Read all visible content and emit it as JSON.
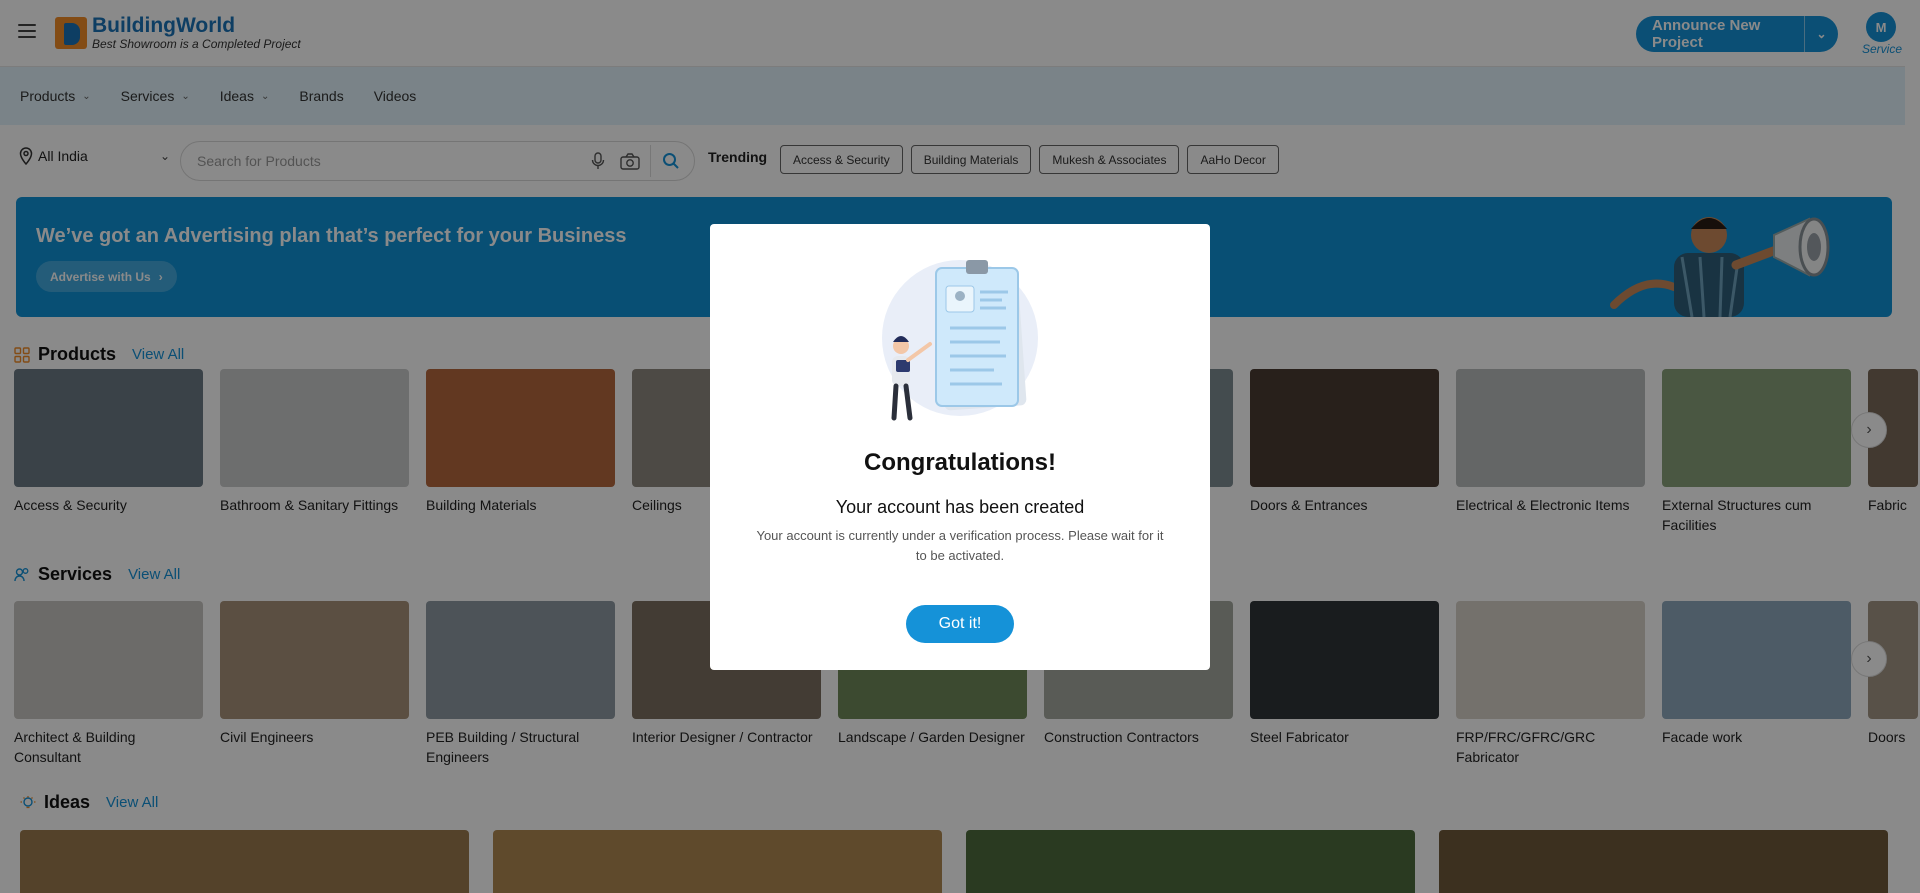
{
  "header": {
    "logo_name": "BuildingWorld",
    "logo_tagline": "Best Showroom is a Completed Project",
    "announce_label": "Announce New Project",
    "avatar_initial": "M",
    "avatar_label": "Service"
  },
  "nav": [
    {
      "label": "Products",
      "dropdown": true
    },
    {
      "label": "Services",
      "dropdown": true
    },
    {
      "label": "Ideas",
      "dropdown": true
    },
    {
      "label": "Brands",
      "dropdown": false
    },
    {
      "label": "Videos",
      "dropdown": false
    }
  ],
  "search": {
    "location": "All India",
    "placeholder": "Search for Products",
    "trending_label": "Trending",
    "chips": [
      "Access & Security",
      "Building Materials",
      "Mukesh & Associates",
      "AaHo Decor"
    ]
  },
  "banner": {
    "text": "We’ve got an Advertising plan that’s perfect for your Business",
    "button": "Advertise with Us"
  },
  "products": {
    "title": "Products",
    "view_all": "View All",
    "items": [
      {
        "label": "Access & Security",
        "color": "#6c7a85"
      },
      {
        "label": "Bathroom & Sanitary Fittings",
        "color": "#c9cbcc"
      },
      {
        "label": "Building Materials",
        "color": "#b5683d"
      },
      {
        "label": "Ceilings",
        "color": "#8f8a80"
      },
      {
        "label": "",
        "color": "#9aa0a4"
      },
      {
        "label": "",
        "color": "#7f8c93"
      },
      {
        "label": "Doors & Entrances",
        "color": "#4a3b32"
      },
      {
        "label": "Electrical & Electronic Items",
        "color": "#b9bcbd"
      },
      {
        "label": "External Structures cum Facilities",
        "color": "#8aa17a"
      },
      {
        "label": "Fabric",
        "color": "#7a6a5a"
      }
    ]
  },
  "services": {
    "title": "Services",
    "view_all": "View All",
    "items": [
      {
        "label": "Architect & Building Consultant",
        "color": "#c8c6c2"
      },
      {
        "label": "Civil Engineers",
        "color": "#a8937a"
      },
      {
        "label": "PEB Building / Structural Engineers",
        "color": "#8f9aa3"
      },
      {
        "label": "Interior Designer / Contractor",
        "color": "#7d6f60"
      },
      {
        "label": "Landscape / Garden Designer",
        "color": "#6f8a5a"
      },
      {
        "label": "Construction Contractors",
        "color": "#a4a9a0"
      },
      {
        "label": "Steel Fabricator",
        "color": "#2f3438"
      },
      {
        "label": "FRP/FRC/GFRC/GRC Fabricator",
        "color": "#d6d1c8"
      },
      {
        "label": "Facade work",
        "color": "#8ea8bd"
      },
      {
        "label": "Doors",
        "color": "#a39685"
      }
    ]
  },
  "ideas": {
    "title": "Ideas",
    "view_all": "View All",
    "items": [
      {
        "color": "#9c7a4e"
      },
      {
        "color": "#b08a52"
      },
      {
        "color": "#4f6b3e"
      },
      {
        "color": "#6f5a3a"
      }
    ]
  },
  "modal": {
    "title": "Congratulations!",
    "subtitle": "Your account has been created",
    "description": "Your account is currently under a verification process. Please wait for it to be activated.",
    "button": "Got it!"
  },
  "colors": {
    "brand_blue": "#1592d8",
    "logo_orange": "#f28c28",
    "nav_bg": "#e1f3fb",
    "overlay": "rgba(0,0,0,0.46)"
  },
  "icons": [
    "hamburger-icon",
    "location-pin-icon",
    "microphone-icon",
    "camera-icon",
    "search-icon",
    "chevron-right-icon",
    "products-grid-icon",
    "services-icon",
    "ideas-bulb-icon"
  ]
}
